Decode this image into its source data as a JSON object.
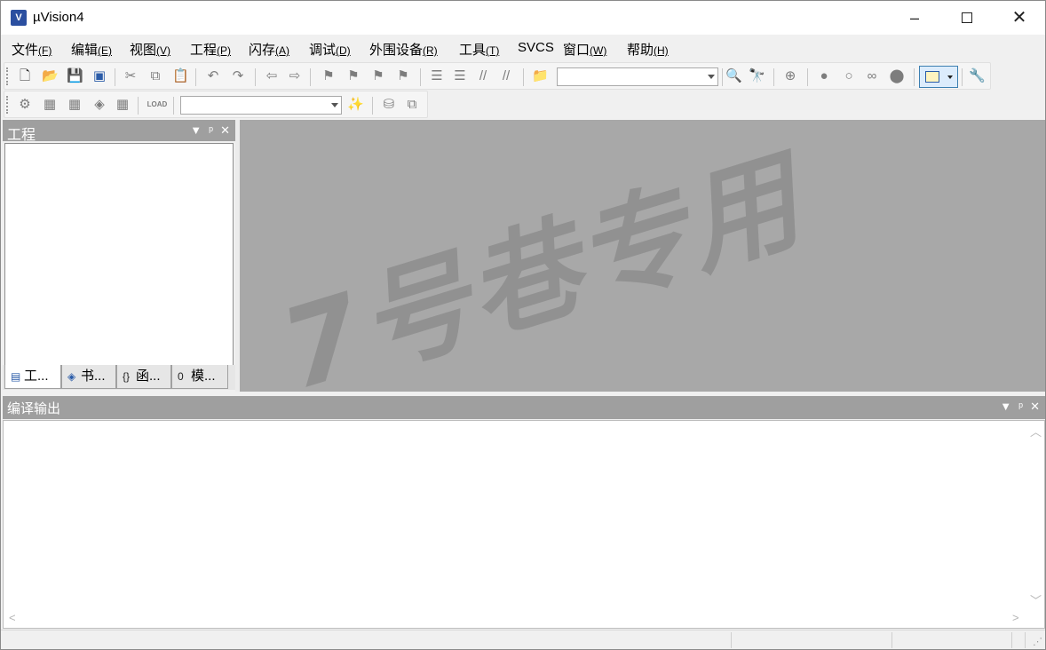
{
  "window": {
    "title": "µVision4",
    "app_icon_label": "V",
    "controls": {
      "minimize": "–",
      "maximize": "",
      "close": "✕"
    }
  },
  "menu": [
    {
      "label": "文件",
      "accel": "(F)"
    },
    {
      "label": "编辑",
      "accel": "(E)"
    },
    {
      "label": "视图",
      "accel": "(V)"
    },
    {
      "label": "工程",
      "accel": "(P)"
    },
    {
      "label": "闪存",
      "accel": "(A)"
    },
    {
      "label": "调试",
      "accel": "(D)"
    },
    {
      "label": "外围设备",
      "accel": "(R)"
    },
    {
      "label": "工具",
      "accel": "(T)"
    },
    {
      "label": "SVCS",
      "accel": ""
    },
    {
      "label": "窗口",
      "accel": "(W)"
    },
    {
      "label": "帮助",
      "accel": "(H)"
    }
  ],
  "toolbar_build": {
    "target_combo": "",
    "load_label": "LOAD"
  },
  "project_panel": {
    "title": "工程",
    "tabs": [
      {
        "label": "工...",
        "icon": "project-icon"
      },
      {
        "label": "书...",
        "icon": "books-icon"
      },
      {
        "label": "函...",
        "icon": "functions-icon",
        "glyph": "{}"
      },
      {
        "label": "模...",
        "icon": "templates-icon",
        "glyph": "0"
      }
    ]
  },
  "build_output": {
    "title": "编译输出"
  },
  "watermark": "7号巷专用",
  "colors": {
    "panel_header": "#9f9f9f",
    "editor_bg": "#a8a8a8",
    "window_bg": "#f0f0f0",
    "selection_blue": "#dcecfc"
  }
}
